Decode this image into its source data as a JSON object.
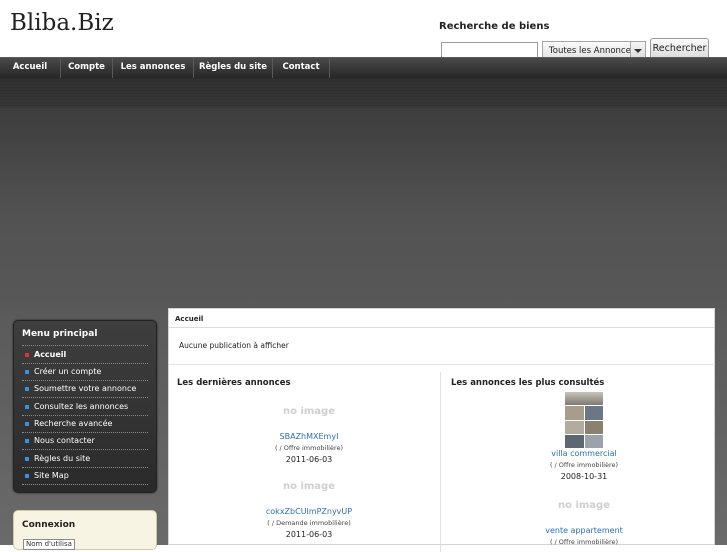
{
  "header": {
    "logo": "Bliba.Biz",
    "search_title": "Recherche de biens",
    "search_value": "",
    "category_selected": "Toutes les Annonces",
    "search_button": "Rechercher"
  },
  "nav": {
    "items": [
      {
        "label": "Accueil"
      },
      {
        "label": "Compte"
      },
      {
        "label": "Les annonces"
      },
      {
        "label": "Règles du site"
      },
      {
        "label": "Contact"
      }
    ]
  },
  "sidebar": {
    "menu_title": "Menu principal",
    "items": [
      {
        "label": "Accueil",
        "active": true
      },
      {
        "label": "Créer un compte"
      },
      {
        "label": "Soumettre votre annonce"
      },
      {
        "label": "Consultez les annonces"
      },
      {
        "label": "Recherche avancée"
      },
      {
        "label": "Nous contacter"
      },
      {
        "label": "Règles du site"
      },
      {
        "label": "Site Map"
      }
    ],
    "login_title": "Connexion",
    "login_field_placeholder": "Nom d'utilisa"
  },
  "main": {
    "breadcrumb": "Accueil",
    "no_publication": "Aucune publication à afficher",
    "latest": {
      "title": "Les dernières annonces",
      "items": [
        {
          "image": "no image",
          "title": "SBAZhMXEmyI",
          "type": "( / Offre immobilière)",
          "date": "2011-06-03"
        },
        {
          "image": "no image",
          "title": "cokxZbCUlmPZnyvUP",
          "type": "( / Demande immobilière)",
          "date": "2011-06-03"
        }
      ]
    },
    "popular": {
      "title": "Les annonces les plus consultés",
      "items": [
        {
          "image": "photo",
          "title": "villa commercial",
          "type": "( / Offre immobilière)",
          "date": "2008-10-31"
        },
        {
          "image": "no image",
          "title": "vente appartement",
          "type": "( / Offre immobilière)",
          "date": ""
        }
      ]
    }
  },
  "colors": {
    "nav_bg": "#2f2f2f",
    "link": "#2a6fb3",
    "bullet": "#3b8fe0",
    "bullet_active": "#dd3333"
  }
}
